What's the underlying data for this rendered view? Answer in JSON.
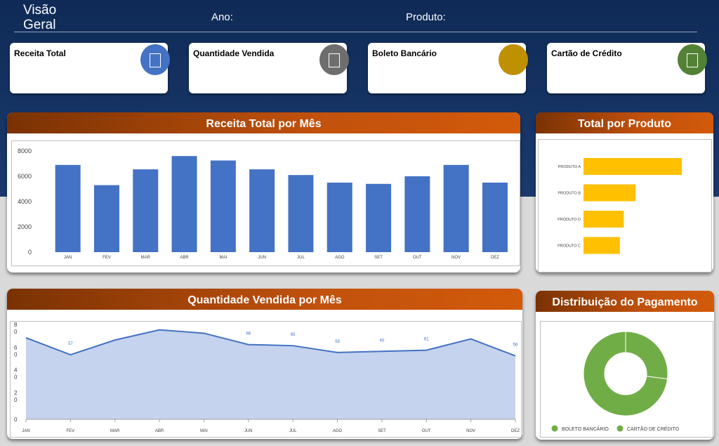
{
  "header": {
    "title": "Visão Geral",
    "year_label": "Ano:",
    "product_label": "Produto:"
  },
  "kpis": [
    {
      "label": "Receita Total",
      "color": "#4472c4",
      "icon": "document-icon"
    },
    {
      "label": "Quantidade Vendida",
      "color": "#6e6e6e",
      "icon": "document-icon"
    },
    {
      "label": "Boleto Bancário",
      "color": "#bf9000",
      "icon": "document-icon"
    },
    {
      "label": "Cartão de Crédito",
      "color": "#538135",
      "icon": "document-icon"
    }
  ],
  "colors": {
    "bar": "#4472c4",
    "hbar": "#ffc000",
    "area_fill": "#c5d3ee",
    "area_line": "#4472c4",
    "donut": "#70ad47"
  },
  "panels": {
    "revenue_title": "Receita Total por Mês",
    "product_title": "Total por Produto",
    "quantity_title": "Quantidade Vendida por Mês",
    "payment_title": "Distribuição do Pagamento"
  },
  "chart_data": [
    {
      "type": "bar",
      "title": "Receita Total por Mês",
      "categories": [
        "JAN",
        "FEV",
        "MAR",
        "ABR",
        "MAI",
        "JUN",
        "JUL",
        "AGO",
        "SET",
        "OUT",
        "NOV",
        "DEZ"
      ],
      "values": [
        6900,
        5300,
        6550,
        7600,
        7250,
        6550,
        6100,
        5500,
        5400,
        6000,
        6900,
        5500
      ],
      "ylim": [
        0,
        8000
      ],
      "yticks": [
        "0",
        "2000",
        "4000",
        "6000",
        "8000"
      ]
    },
    {
      "type": "bar",
      "orientation": "horizontal",
      "title": "Total por Produto",
      "categories": [
        "PRODUTO A",
        "PRODUTO B",
        "PRODUTO D",
        "PRODUTO C"
      ],
      "values": [
        100,
        53,
        41,
        37
      ]
    },
    {
      "type": "area",
      "title": "Quantidade Vendida por Mês",
      "categories": [
        "JAN",
        "FEV",
        "MAR",
        "ABR",
        "MAI",
        "JUN",
        "JUL",
        "AGO",
        "SET",
        "OUT",
        "NOV",
        "DEZ"
      ],
      "values": [
        72,
        57,
        70,
        79,
        76,
        66,
        65,
        59,
        60,
        61,
        71,
        56
      ],
      "data_labels": [
        "",
        "57",
        "",
        "",
        "",
        "66",
        "65",
        "59",
        "60",
        "61",
        "",
        "56"
      ],
      "ylim": [
        0,
        80
      ],
      "yticks": [
        [
          "0"
        ],
        [
          "2",
          "0"
        ],
        [
          "4",
          "0"
        ],
        [
          "6",
          "0"
        ],
        [
          "8",
          "0"
        ]
      ]
    },
    {
      "type": "pie",
      "subtype": "donut",
      "title": "Distribuição do Pagamento",
      "labels": [
        "BOLETO BANCÁRIO",
        "CARTÃO DE CRÉDITO"
      ],
      "values": [
        27,
        73
      ],
      "colors": [
        "#70ad47",
        "#70ad47"
      ],
      "legend": "bottom"
    }
  ]
}
